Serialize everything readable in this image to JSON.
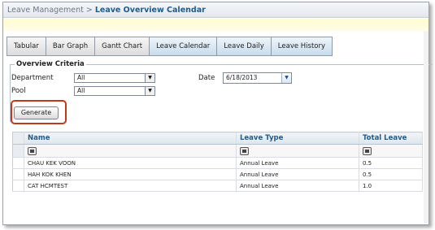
{
  "titlebar": {
    "parent": "Leave Management",
    "separator": ">",
    "current": "Leave Overview Calendar"
  },
  "tabs": [
    {
      "label": "Tabular",
      "style": "gray"
    },
    {
      "label": "Bar Graph",
      "style": "gray"
    },
    {
      "label": "Gantt Chart",
      "style": "gray"
    },
    {
      "label": "Leave Calendar",
      "style": "blue"
    },
    {
      "label": "Leave Daily",
      "style": "blue"
    },
    {
      "label": "Leave History",
      "style": "blue"
    }
  ],
  "criteria": {
    "title": "Overview Criteria",
    "department_label": "Department",
    "department_value": "All",
    "pool_label": "Pool",
    "pool_value": "All",
    "date_label": "Date",
    "date_value": "6/18/2013",
    "generate_label": "Generate"
  },
  "grid": {
    "columns": [
      "Name",
      "Leave Type",
      "Total Leave"
    ],
    "rows": [
      [
        "CHAU KEK VOON",
        "Annual Leave",
        "0.5"
      ],
      [
        "HAH KOK KHEN",
        "Annual Leave",
        "0.5"
      ],
      [
        "CAT HCMTEST",
        "Annual Leave",
        "1.0"
      ]
    ]
  },
  "colors": {
    "title_blue": "#1f5c8b",
    "highlight_red": "#c0391b",
    "band_yellow": "#fffbd0"
  }
}
